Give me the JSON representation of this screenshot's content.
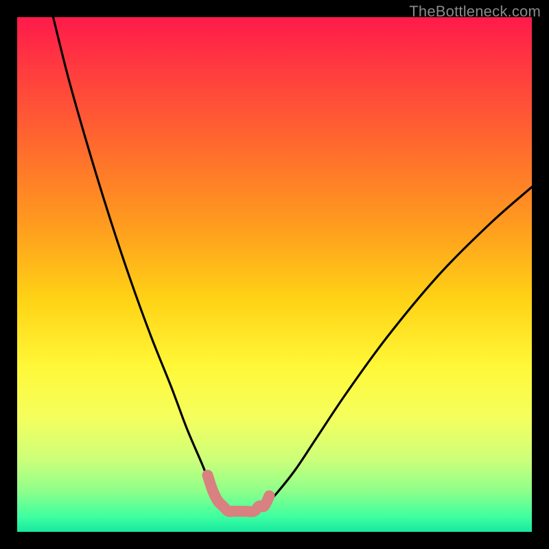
{
  "watermark": "TheBottleneck.com",
  "chart_data": {
    "type": "line",
    "title": "",
    "xlabel": "",
    "ylabel": "",
    "xlim": [
      0,
      100
    ],
    "ylim": [
      0,
      100
    ],
    "grid": false,
    "legend": false,
    "series": [
      {
        "name": "bottleneck-curve",
        "x": [
          7,
          10,
          14,
          18,
          22,
          26,
          30,
          33,
          36,
          38,
          40,
          42,
          46,
          48,
          50,
          54,
          58,
          64,
          72,
          82,
          92,
          100
        ],
        "values": [
          100,
          88,
          74,
          61,
          49,
          38,
          28,
          20,
          13,
          8,
          5,
          4,
          4,
          5,
          7,
          12,
          18,
          27,
          38,
          50,
          60,
          67
        ]
      }
    ],
    "highlight": {
      "name": "flat-basin-highlight",
      "color": "#d98080",
      "x": [
        37,
        38,
        39,
        40,
        41,
        42,
        44,
        46,
        47,
        48,
        49
      ],
      "values": [
        11,
        8,
        6,
        5,
        4,
        4,
        4,
        4,
        5,
        5,
        7
      ]
    },
    "gradient_stops": [
      {
        "pos": 0.0,
        "color": "#ff1a4b"
      },
      {
        "pos": 0.1,
        "color": "#ff3b3f"
      },
      {
        "pos": 0.25,
        "color": "#ff6a2e"
      },
      {
        "pos": 0.4,
        "color": "#ff9a1f"
      },
      {
        "pos": 0.55,
        "color": "#ffd315"
      },
      {
        "pos": 0.68,
        "color": "#fff838"
      },
      {
        "pos": 0.78,
        "color": "#f4ff5e"
      },
      {
        "pos": 0.86,
        "color": "#ccff7a"
      },
      {
        "pos": 0.92,
        "color": "#8fff8a"
      },
      {
        "pos": 0.97,
        "color": "#3fffa0"
      },
      {
        "pos": 1.0,
        "color": "#16e8a0"
      }
    ]
  }
}
